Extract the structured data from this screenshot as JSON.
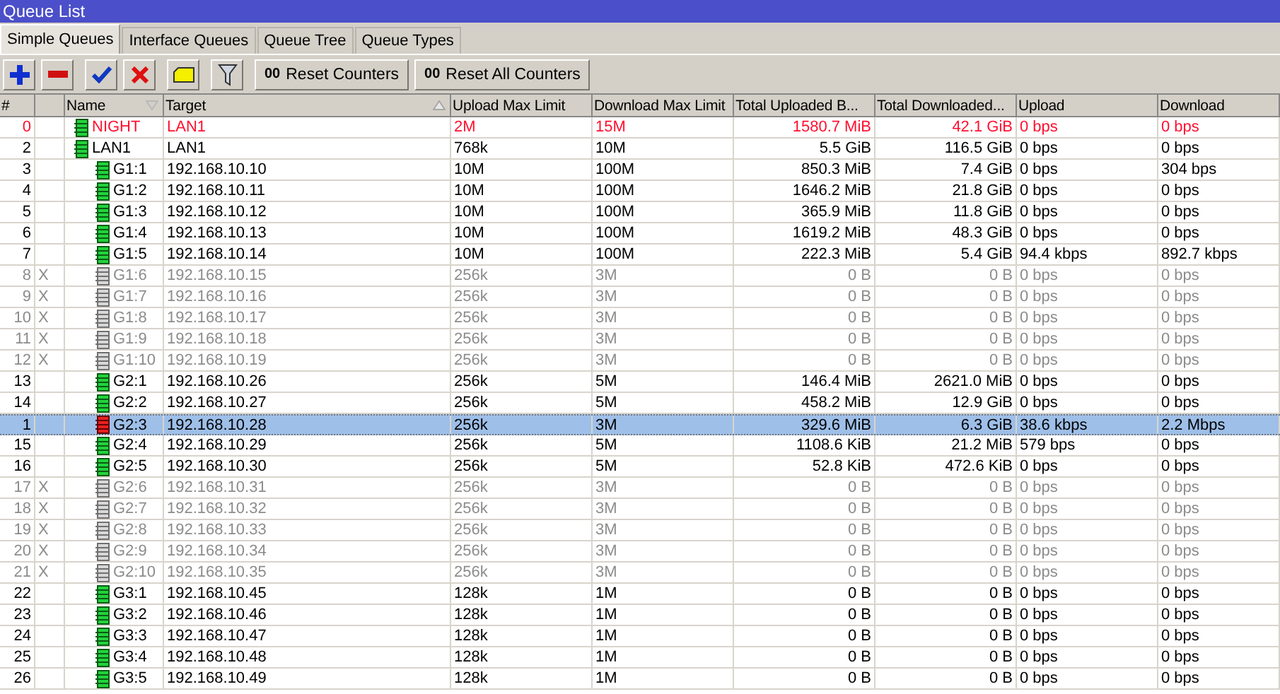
{
  "window": {
    "title": "Queue List"
  },
  "tabs": [
    {
      "label": "Simple Queues",
      "selected": true
    },
    {
      "label": "Interface Queues",
      "selected": false
    },
    {
      "label": "Queue Tree",
      "selected": false
    },
    {
      "label": "Queue Types",
      "selected": false
    }
  ],
  "toolbar": [
    {
      "kind": "add"
    },
    {
      "kind": "remove"
    },
    {
      "kind": "enable"
    },
    {
      "kind": "disable"
    },
    {
      "kind": "comment"
    },
    {
      "kind": "filter"
    },
    {
      "kind": "text",
      "icon_text": "00",
      "label": "Reset Counters"
    },
    {
      "kind": "text",
      "icon_text": "00",
      "label": "Reset All Counters"
    }
  ],
  "table": {
    "columns": [
      {
        "label": "#",
        "sorted": false
      },
      {
        "label": "Name",
        "sorted": true,
        "ascending": false
      },
      {
        "label": "Target",
        "sorted": true,
        "ascending": true
      },
      {
        "label": "Upload Max Limit",
        "sorted": false
      },
      {
        "label": "Download Max Limit",
        "sorted": false
      },
      {
        "label": "Total Uploaded B...",
        "sorted": false
      },
      {
        "label": "Total Downloaded...",
        "sorted": false
      },
      {
        "label": "Upload",
        "sorted": false
      },
      {
        "label": "Download",
        "sorted": false
      }
    ],
    "rows": [
      {
        "num": "0",
        "name": "NIGHT",
        "target": "LAN1",
        "up_limit": "2M",
        "down_limit": "15M",
        "total_up": "1580.7 MiB",
        "total_down": "42.1 GiB",
        "upload": "0 bps",
        "download": "0 bps",
        "disabled": false,
        "invalid": true,
        "selected": false,
        "limited": false
      },
      {
        "num": "2",
        "name": "LAN1",
        "target": "LAN1",
        "up_limit": "768k",
        "down_limit": "10M",
        "total_up": "5.5 GiB",
        "total_down": "116.5 GiB",
        "upload": "0 bps",
        "download": "0 bps",
        "disabled": false,
        "invalid": false,
        "selected": false,
        "limited": false,
        "children": [
          {
            "num": "3",
            "name": "G1:1",
            "target": "192.168.10.10",
            "up_limit": "10M",
            "down_limit": "100M",
            "total_up": "850.3 MiB",
            "total_down": "7.4 GiB",
            "upload": "0 bps",
            "download": "304 bps",
            "disabled": false,
            "invalid": false,
            "selected": false,
            "limited": false
          },
          {
            "num": "4",
            "name": "G1:2",
            "target": "192.168.10.11",
            "up_limit": "10M",
            "down_limit": "100M",
            "total_up": "1646.2 MiB",
            "total_down": "21.8 GiB",
            "upload": "0 bps",
            "download": "0 bps",
            "disabled": false,
            "invalid": false,
            "selected": false,
            "limited": false
          },
          {
            "num": "5",
            "name": "G1:3",
            "target": "192.168.10.12",
            "up_limit": "10M",
            "down_limit": "100M",
            "total_up": "365.9 MiB",
            "total_down": "11.8 GiB",
            "upload": "0 bps",
            "download": "0 bps",
            "disabled": false,
            "invalid": false,
            "selected": false,
            "limited": false
          },
          {
            "num": "6",
            "name": "G1:4",
            "target": "192.168.10.13",
            "up_limit": "10M",
            "down_limit": "100M",
            "total_up": "1619.2 MiB",
            "total_down": "48.3 GiB",
            "upload": "0 bps",
            "download": "0 bps",
            "disabled": false,
            "invalid": false,
            "selected": false,
            "limited": false
          },
          {
            "num": "7",
            "name": "G1:5",
            "target": "192.168.10.14",
            "up_limit": "10M",
            "down_limit": "100M",
            "total_up": "222.3 MiB",
            "total_down": "5.4 GiB",
            "upload": "94.4 kbps",
            "download": "892.7 kbps",
            "disabled": false,
            "invalid": false,
            "selected": false,
            "limited": false
          },
          {
            "num": "8",
            "flag": "X",
            "name": "G1:6",
            "target": "192.168.10.15",
            "up_limit": "256k",
            "down_limit": "3M",
            "total_up": "0 B",
            "total_down": "0 B",
            "upload": "0 bps",
            "download": "0 bps",
            "disabled": true,
            "invalid": false,
            "selected": false,
            "limited": false
          },
          {
            "num": "9",
            "flag": "X",
            "name": "G1:7",
            "target": "192.168.10.16",
            "up_limit": "256k",
            "down_limit": "3M",
            "total_up": "0 B",
            "total_down": "0 B",
            "upload": "0 bps",
            "download": "0 bps",
            "disabled": true,
            "invalid": false,
            "selected": false,
            "limited": false
          },
          {
            "num": "10",
            "flag": "X",
            "name": "G1:8",
            "target": "192.168.10.17",
            "up_limit": "256k",
            "down_limit": "3M",
            "total_up": "0 B",
            "total_down": "0 B",
            "upload": "0 bps",
            "download": "0 bps",
            "disabled": true,
            "invalid": false,
            "selected": false,
            "limited": false
          },
          {
            "num": "11",
            "flag": "X",
            "name": "G1:9",
            "target": "192.168.10.18",
            "up_limit": "256k",
            "down_limit": "3M",
            "total_up": "0 B",
            "total_down": "0 B",
            "upload": "0 bps",
            "download": "0 bps",
            "disabled": true,
            "invalid": false,
            "selected": false,
            "limited": false
          },
          {
            "num": "12",
            "flag": "X",
            "name": "G1:10",
            "target": "192.168.10.19",
            "up_limit": "256k",
            "down_limit": "3M",
            "total_up": "0 B",
            "total_down": "0 B",
            "upload": "0 bps",
            "download": "0 bps",
            "disabled": true,
            "invalid": false,
            "selected": false,
            "limited": false
          },
          {
            "num": "13",
            "name": "G2:1",
            "target": "192.168.10.26",
            "up_limit": "256k",
            "down_limit": "5M",
            "total_up": "146.4 MiB",
            "total_down": "2621.0 MiB",
            "upload": "0 bps",
            "download": "0 bps",
            "disabled": false,
            "invalid": false,
            "selected": false,
            "limited": false
          },
          {
            "num": "14",
            "name": "G2:2",
            "target": "192.168.10.27",
            "up_limit": "256k",
            "down_limit": "5M",
            "total_up": "458.2 MiB",
            "total_down": "12.9 GiB",
            "upload": "0 bps",
            "download": "0 bps",
            "disabled": false,
            "invalid": false,
            "selected": false,
            "limited": false
          },
          {
            "num": "1",
            "name": "G2:3",
            "target": "192.168.10.28",
            "up_limit": "256k",
            "down_limit": "3M",
            "total_up": "329.6 MiB",
            "total_down": "6.3 GiB",
            "upload": "38.6 kbps",
            "download": "2.2 Mbps",
            "disabled": false,
            "invalid": false,
            "selected": true,
            "limited": true
          },
          {
            "num": "15",
            "name": "G2:4",
            "target": "192.168.10.29",
            "up_limit": "256k",
            "down_limit": "5M",
            "total_up": "1108.6 KiB",
            "total_down": "21.2 MiB",
            "upload": "579 bps",
            "download": "0 bps",
            "disabled": false,
            "invalid": false,
            "selected": false,
            "limited": false
          },
          {
            "num": "16",
            "name": "G2:5",
            "target": "192.168.10.30",
            "up_limit": "256k",
            "down_limit": "5M",
            "total_up": "52.8 KiB",
            "total_down": "472.6 KiB",
            "upload": "0 bps",
            "download": "0 bps",
            "disabled": false,
            "invalid": false,
            "selected": false,
            "limited": false
          },
          {
            "num": "17",
            "flag": "X",
            "name": "G2:6",
            "target": "192.168.10.31",
            "up_limit": "256k",
            "down_limit": "3M",
            "total_up": "0 B",
            "total_down": "0 B",
            "upload": "0 bps",
            "download": "0 bps",
            "disabled": true,
            "invalid": false,
            "selected": false,
            "limited": false
          },
          {
            "num": "18",
            "flag": "X",
            "name": "G2:7",
            "target": "192.168.10.32",
            "up_limit": "256k",
            "down_limit": "3M",
            "total_up": "0 B",
            "total_down": "0 B",
            "upload": "0 bps",
            "download": "0 bps",
            "disabled": true,
            "invalid": false,
            "selected": false,
            "limited": false
          },
          {
            "num": "19",
            "flag": "X",
            "name": "G2:8",
            "target": "192.168.10.33",
            "up_limit": "256k",
            "down_limit": "3M",
            "total_up": "0 B",
            "total_down": "0 B",
            "upload": "0 bps",
            "download": "0 bps",
            "disabled": true,
            "invalid": false,
            "selected": false,
            "limited": false
          },
          {
            "num": "20",
            "flag": "X",
            "name": "G2:9",
            "target": "192.168.10.34",
            "up_limit": "256k",
            "down_limit": "3M",
            "total_up": "0 B",
            "total_down": "0 B",
            "upload": "0 bps",
            "download": "0 bps",
            "disabled": true,
            "invalid": false,
            "selected": false,
            "limited": false
          },
          {
            "num": "21",
            "flag": "X",
            "name": "G2:10",
            "target": "192.168.10.35",
            "up_limit": "256k",
            "down_limit": "3M",
            "total_up": "0 B",
            "total_down": "0 B",
            "upload": "0 bps",
            "download": "0 bps",
            "disabled": true,
            "invalid": false,
            "selected": false,
            "limited": false
          },
          {
            "num": "22",
            "name": "G3:1",
            "target": "192.168.10.45",
            "up_limit": "128k",
            "down_limit": "1M",
            "total_up": "0 B",
            "total_down": "0 B",
            "upload": "0 bps",
            "download": "0 bps",
            "disabled": false,
            "invalid": false,
            "selected": false,
            "limited": false
          },
          {
            "num": "23",
            "name": "G3:2",
            "target": "192.168.10.46",
            "up_limit": "128k",
            "down_limit": "1M",
            "total_up": "0 B",
            "total_down": "0 B",
            "upload": "0 bps",
            "download": "0 bps",
            "disabled": false,
            "invalid": false,
            "selected": false,
            "limited": false
          },
          {
            "num": "24",
            "name": "G3:3",
            "target": "192.168.10.47",
            "up_limit": "128k",
            "down_limit": "1M",
            "total_up": "0 B",
            "total_down": "0 B",
            "upload": "0 bps",
            "download": "0 bps",
            "disabled": false,
            "invalid": false,
            "selected": false,
            "limited": false
          },
          {
            "num": "25",
            "name": "G3:4",
            "target": "192.168.10.48",
            "up_limit": "128k",
            "down_limit": "1M",
            "total_up": "0 B",
            "total_down": "0 B",
            "upload": "0 bps",
            "download": "0 bps",
            "disabled": false,
            "invalid": false,
            "selected": false,
            "limited": false
          },
          {
            "num": "26",
            "name": "G3:5",
            "target": "192.168.10.49",
            "up_limit": "128k",
            "down_limit": "1M",
            "total_up": "0 B",
            "total_down": "0 B",
            "upload": "0 bps",
            "download": "0 bps",
            "disabled": false,
            "invalid": false,
            "selected": false,
            "limited": false
          }
        ]
      }
    ]
  }
}
